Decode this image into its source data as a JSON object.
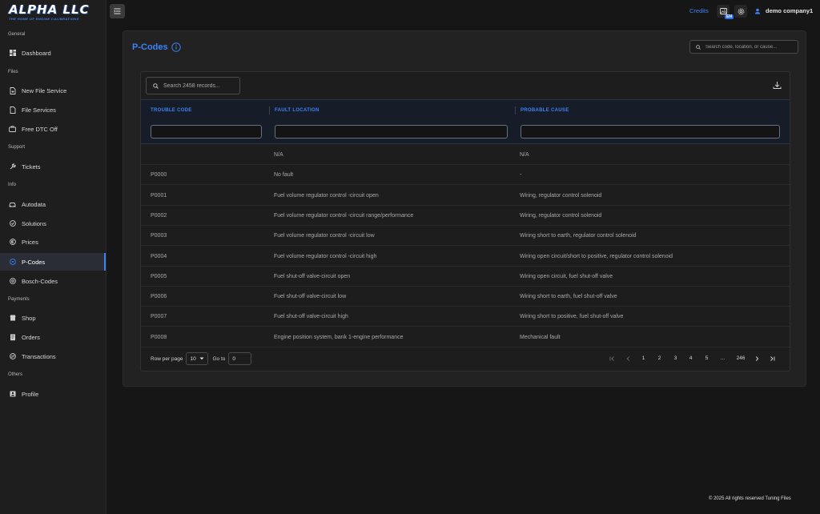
{
  "brand": {
    "name": "ALPHA LLC",
    "tagline": "THE HOME OF ENGINE CALIBRATIONS"
  },
  "colors": {
    "accent": "#3b82f6",
    "background": "#161616",
    "sidebar": "#1e1e1e",
    "card": "#222222",
    "table_header": "#171d28"
  },
  "sidebar": {
    "sections": [
      {
        "label": "General"
      },
      {
        "label": "Files"
      },
      {
        "label": "Support"
      },
      {
        "label": "Info"
      },
      {
        "label": "Payments"
      },
      {
        "label": "Others"
      }
    ],
    "items": [
      {
        "label": "Dashboard",
        "icon": "dashboard-icon"
      },
      {
        "label": "New File Service",
        "icon": "file-plus-icon"
      },
      {
        "label": "File Services",
        "icon": "file-icon"
      },
      {
        "label": "Free DTC Off",
        "icon": "briefcase-icon"
      },
      {
        "label": "Tickets",
        "icon": "wrench-icon"
      },
      {
        "label": "Autodata",
        "icon": "car-icon"
      },
      {
        "label": "Solutions",
        "icon": "check-circle-icon"
      },
      {
        "label": "Prices",
        "icon": "euro-icon"
      },
      {
        "label": "P-Codes",
        "icon": "p-circle-icon"
      },
      {
        "label": "Bosch-Codes",
        "icon": "b-circle-icon"
      },
      {
        "label": "Shop",
        "icon": "shop-icon"
      },
      {
        "label": "Orders",
        "icon": "receipt-icon"
      },
      {
        "label": "Transactions",
        "icon": "exchange-icon"
      },
      {
        "label": "Profile",
        "icon": "profile-icon"
      }
    ],
    "active": "P-Codes"
  },
  "header": {
    "credits_label": "Credits",
    "language_badge": "EN",
    "user_name": "demo company1"
  },
  "page": {
    "title": "P-Codes",
    "top_search_placeholder": "Search code, location, or cause...",
    "records_search_placeholder": "Search 2458 records..."
  },
  "table": {
    "columns": [
      "TROUBLE CODE",
      "FAULT LOCATION",
      "PROBABLE CAUSE"
    ],
    "rows": [
      {
        "code": "",
        "location": "N/A",
        "cause": "N/A"
      },
      {
        "code": "P0000",
        "location": "No fault",
        "cause": "-"
      },
      {
        "code": "P0001",
        "location": "Fuel volume regulator control -circuit open",
        "cause": "Wiring, regulator control solenoid"
      },
      {
        "code": "P0002",
        "location": "Fuel volume regulator control -circuit range/performance",
        "cause": "Wiring, regulator control solenoid"
      },
      {
        "code": "P0003",
        "location": "Fuel volume regulator control -circuit low",
        "cause": "Wiring short to earth, regulator control solenoid"
      },
      {
        "code": "P0004",
        "location": "Fuel volume regulator control -circuit high",
        "cause": "Wiring open circuit/short to positive, regulator control solenoid"
      },
      {
        "code": "P0005",
        "location": "Fuel shut-off valve-circuit open",
        "cause": "Wiring open circuit, fuel shut-off valve"
      },
      {
        "code": "P0006",
        "location": "Fuel shut-off valve-circuit low",
        "cause": "Wiring short to earth, fuel shut-off valve"
      },
      {
        "code": "P0007",
        "location": "Fuel shut-off valve-circuit high",
        "cause": "Wiring short to positive, fuel shut-off valve"
      },
      {
        "code": "P0008",
        "location": "Engine position system, bank 1-engine performance",
        "cause": "Mechanical fault"
      }
    ]
  },
  "pagination": {
    "rows_per_page_label": "Row per page",
    "rows_per_page_value": "10",
    "goto_label": "Go to",
    "goto_value": "0",
    "pages": [
      "1",
      "2",
      "3",
      "4",
      "5",
      "...",
      "246"
    ]
  },
  "footer": {
    "text": "© 2025 All rights reserved Tuning Files"
  }
}
